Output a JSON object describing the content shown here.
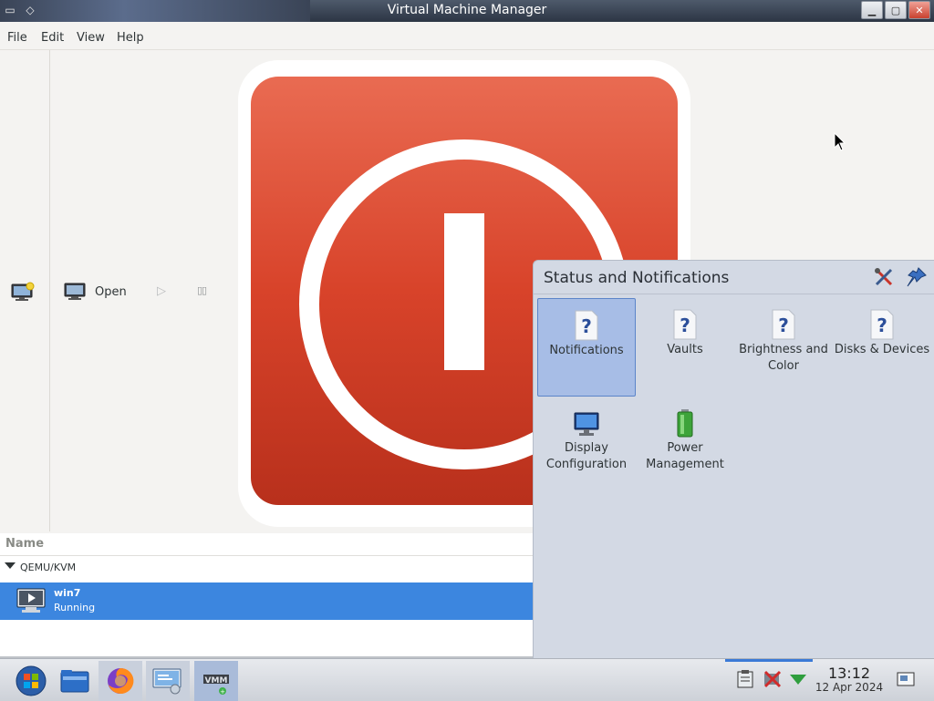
{
  "window": {
    "title": "Virtual Machine Manager",
    "buttons": {
      "minimize": "minimize-icon",
      "maximize": "maximize-icon",
      "close": "close-icon"
    }
  },
  "menu": {
    "file": "File",
    "edit": "Edit",
    "view": "View",
    "help": "Help"
  },
  "toolbar": {
    "open_label": "Open"
  },
  "vm_list": {
    "header": "Name",
    "group": "QEMU/KVM",
    "vms": [
      {
        "name": "win7",
        "state": "Running"
      }
    ]
  },
  "panel": {
    "title": "Status and Notifications",
    "items": [
      {
        "label": "Notifications",
        "icon": "help-question-icon",
        "selected": true
      },
      {
        "label": "Vaults",
        "icon": "help-question-icon"
      },
      {
        "label": "Brightness and Color",
        "icon": "help-question-icon"
      },
      {
        "label": "Disks & Devices",
        "icon": "help-question-icon"
      },
      {
        "label": "Display Configuration",
        "icon": "monitor-icon"
      },
      {
        "label": "Power Management",
        "icon": "battery-icon"
      }
    ]
  },
  "taskbar": {
    "time": "13:12",
    "date": "12 Apr 2024"
  },
  "colors": {
    "selection": "#3c86df",
    "panel_bg": "#d3d9e4",
    "splash_red": "#d8432a"
  }
}
